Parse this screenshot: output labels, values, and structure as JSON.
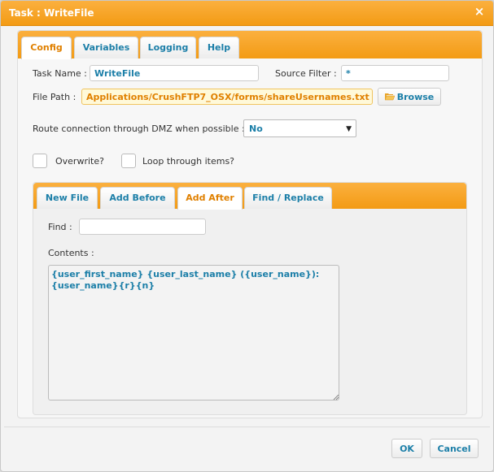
{
  "dialog": {
    "title": "Task : WriteFile",
    "close_glyph": "×"
  },
  "tabs": [
    {
      "label": "Config"
    },
    {
      "label": "Variables"
    },
    {
      "label": "Logging"
    },
    {
      "label": "Help"
    }
  ],
  "active_tab": "Config",
  "config": {
    "task_name_label": "Task Name :",
    "task_name_value": "WriteFile",
    "source_filter_label": "Source Filter :",
    "source_filter_value": "*",
    "file_path_label": "File Path :",
    "file_path_value": "Applications/CrushFTP7_OSX/forms/shareUsernames.txt",
    "browse_label": "Browse",
    "dmz_label": "Route connection through DMZ when possible :",
    "dmz_value": "No",
    "overwrite_label": "Overwrite?",
    "overwrite_checked": false,
    "loop_label": "Loop through items?",
    "loop_checked": false
  },
  "inner_tabs": [
    {
      "label": "New File"
    },
    {
      "label": "Add Before"
    },
    {
      "label": "Add After"
    },
    {
      "label": "Find / Replace"
    }
  ],
  "active_inner_tab": "Add After",
  "add_after": {
    "find_label": "Find :",
    "find_value": "",
    "contents_label": "Contents :",
    "contents_value": "{user_first_name} {user_last_name} ({user_name}):\n{user_name}{r}{n}"
  },
  "footer": {
    "ok_label": "OK",
    "cancel_label": "Cancel"
  },
  "icons": {
    "close": "close-icon",
    "browse": "folder-open-icon",
    "select": "chevron-down-icon",
    "resize": "resize-grip-icon"
  },
  "colors": {
    "accent_orange": "#f39b14",
    "link_blue": "#1c7fa8",
    "active_tab_text": "#e08000",
    "highlight_field": "#fff9d9"
  }
}
